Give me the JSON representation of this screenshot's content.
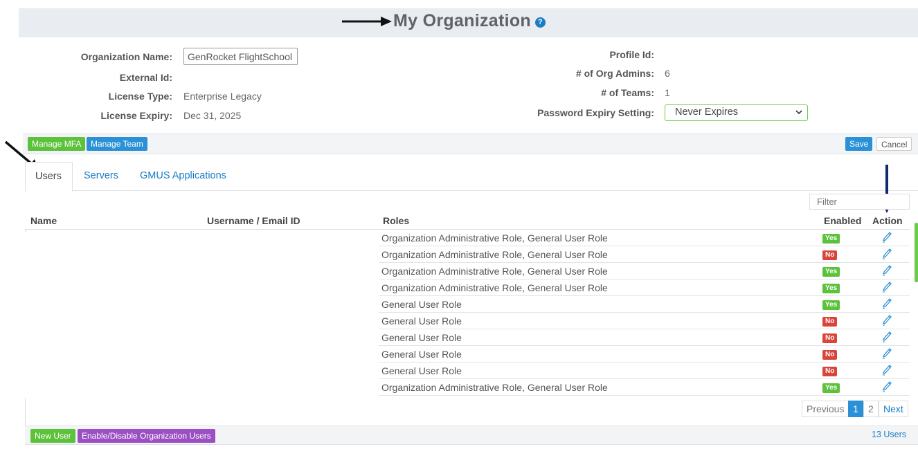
{
  "page": {
    "title": "My Organization",
    "help_icon": "question-circle-icon"
  },
  "org": {
    "labels": {
      "name": "Organization Name:",
      "external_id": "External Id:",
      "license_type": "License Type:",
      "license_expiry": "License Expiry:",
      "profile_id": "Profile Id:",
      "org_admins": "# of Org Admins:",
      "teams": "# of Teams:",
      "password_expiry": "Password Expiry Setting:"
    },
    "values": {
      "name": "GenRocket FlightSchool",
      "external_id": "",
      "license_type": "Enterprise Legacy",
      "license_expiry": "Dec 31, 2025",
      "profile_id": "",
      "org_admins": "6",
      "teams": "1",
      "password_expiry": "Never Expires"
    }
  },
  "toolbar": {
    "manage_mfa": "Manage MFA",
    "manage_team": "Manage Team",
    "save": "Save",
    "cancel": "Cancel"
  },
  "tabs": [
    {
      "label": "Users",
      "active": true
    },
    {
      "label": "Servers",
      "active": false
    },
    {
      "label": "GMUS Applications",
      "active": false
    }
  ],
  "filter": {
    "placeholder": "Filter"
  },
  "table": {
    "headers": {
      "name": "Name",
      "username": "Username / Email ID",
      "roles": "Roles",
      "enabled": "Enabled",
      "action": "Action"
    },
    "rows": [
      {
        "roles": "Organization Administrative Role, General User Role",
        "enabled": "Yes"
      },
      {
        "roles": "Organization Administrative Role, General User Role",
        "enabled": "No"
      },
      {
        "roles": "Organization Administrative Role, General User Role",
        "enabled": "Yes"
      },
      {
        "roles": "Organization Administrative Role, General User Role",
        "enabled": "Yes"
      },
      {
        "roles": "General User Role",
        "enabled": "Yes"
      },
      {
        "roles": "General User Role",
        "enabled": "No"
      },
      {
        "roles": "General User Role",
        "enabled": "No"
      },
      {
        "roles": "General User Role",
        "enabled": "No"
      },
      {
        "roles": "General User Role",
        "enabled": "No"
      },
      {
        "roles": "Organization Administrative Role, General User Role",
        "enabled": "Yes"
      }
    ],
    "action_icon": "pencil-edit-icon"
  },
  "pagination": {
    "previous": "Previous",
    "pages": [
      "1",
      "2"
    ],
    "current": "1",
    "next": "Next"
  },
  "footer": {
    "new_user": "New User",
    "enable_disable": "Enable/Disable Organization Users",
    "user_count": "13 Users"
  },
  "colors": {
    "green": "#5cc13b",
    "blue": "#2b91d6",
    "red": "#d9453b",
    "purple": "#9b4fc3",
    "header_bg": "#e9edf1",
    "arrow_dark_blue": "#0d2a6e"
  }
}
